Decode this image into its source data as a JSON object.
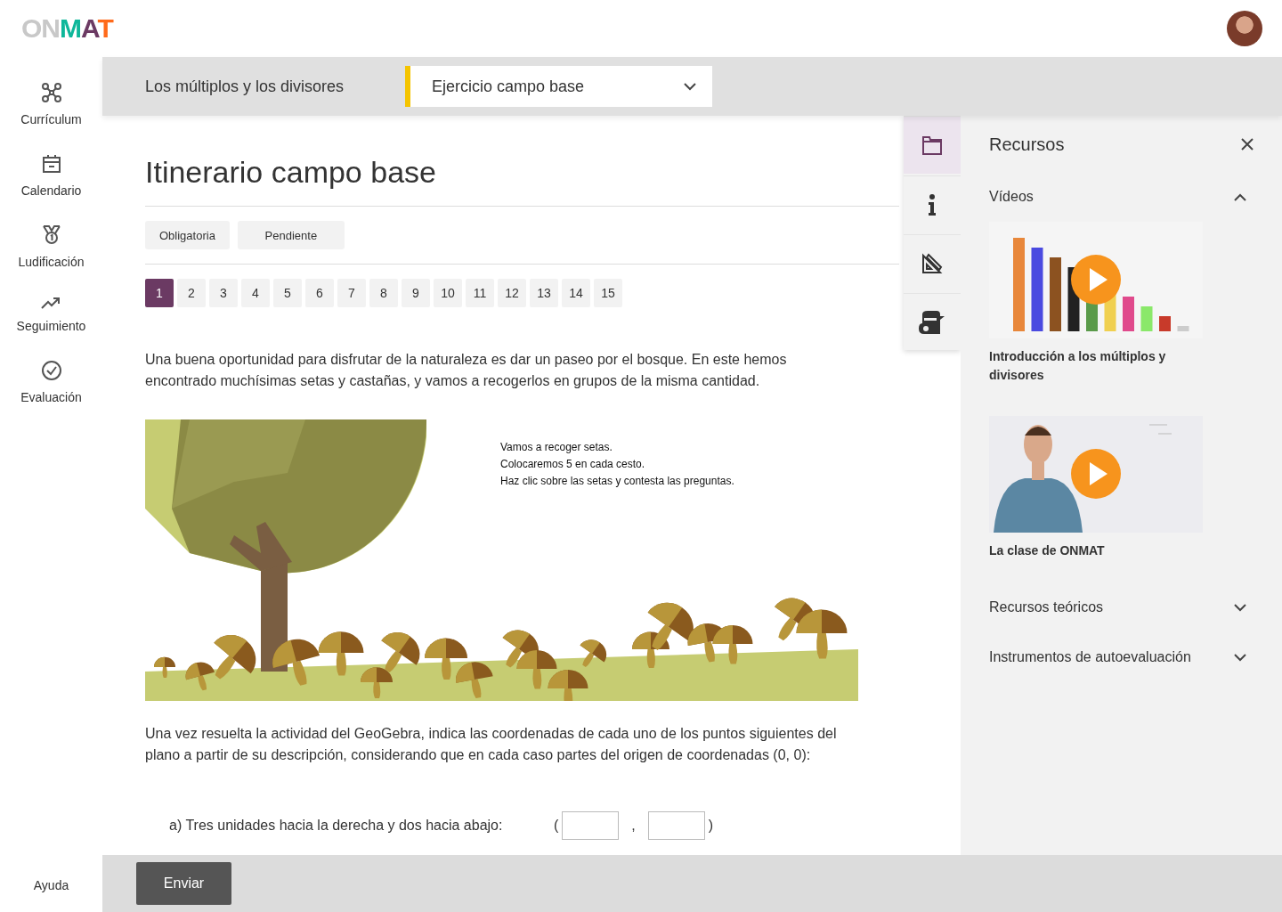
{
  "header": {
    "logo": "ONMAT"
  },
  "sidebar": {
    "items": [
      {
        "label": "Currículum"
      },
      {
        "label": "Calendario"
      },
      {
        "label": "Ludificación"
      },
      {
        "label": "Seguimiento"
      },
      {
        "label": "Evaluación"
      }
    ],
    "help": "Ayuda"
  },
  "topic_bar": {
    "title": "Los múltiplos y los divisores",
    "exercise_select": {
      "value": "Ejercicio campo base"
    }
  },
  "lesson": {
    "title": "Itinerario campo base",
    "tags": [
      "Obligatoria",
      "Pendiente"
    ],
    "pages": [
      {
        "label": "1",
        "selected": true
      },
      {
        "label": "2",
        "selected": false
      },
      {
        "label": "3",
        "selected": false
      },
      {
        "label": "4",
        "selected": false
      },
      {
        "label": "5",
        "selected": false
      },
      {
        "label": "6",
        "selected": false
      },
      {
        "label": "7",
        "selected": false
      },
      {
        "label": "8",
        "selected": false
      },
      {
        "label": "9",
        "selected": false
      },
      {
        "label": "10",
        "selected": false
      },
      {
        "label": "11",
        "selected": false
      },
      {
        "label": "12",
        "selected": false
      },
      {
        "label": "13",
        "selected": false
      },
      {
        "label": "14",
        "selected": false
      },
      {
        "label": "15",
        "selected": false
      }
    ],
    "intro": "Una buena oportunidad para disfrutar de la naturaleza es dar un paseo por el bosque. En este hemos encontrado muchísimas setas y castañas, y vamos a recogerlos en grupos de la misma cantidad.",
    "applet": {
      "lines": [
        "Vamos a recoger setas.",
        "Colocaremos 5 en cada cesto.",
        "Haz clic sobre las setas y contesta las preguntas."
      ]
    },
    "question": "Una vez resuelta la actividad del GeoGebra, indica las coordenadas de cada uno de los puntos siguientes del plano a partir de su descripción, considerando que en cada caso partes del origen de coordenadas (0, 0):",
    "answers": [
      {
        "label": "a) Tres unidades hacia la derecha y dos hacia abajo:",
        "open": "(",
        "separator": ",",
        "close": ")"
      }
    ]
  },
  "tools": [
    {
      "selected": true
    },
    {
      "selected": false
    },
    {
      "selected": false
    },
    {
      "selected": false
    }
  ],
  "resources": {
    "title": "Recursos",
    "sections": [
      {
        "title": "Vídeos",
        "expanded": true,
        "videos": [
          {
            "title": "Introducción a los múltiplos y divisores"
          },
          {
            "title": "La clase de ONMAT"
          }
        ]
      },
      {
        "title": "Recursos teóricos",
        "expanded": false
      },
      {
        "title": "Instrumentos de autoevaluación",
        "expanded": false
      }
    ]
  },
  "footer": {
    "submit": "Enviar"
  }
}
